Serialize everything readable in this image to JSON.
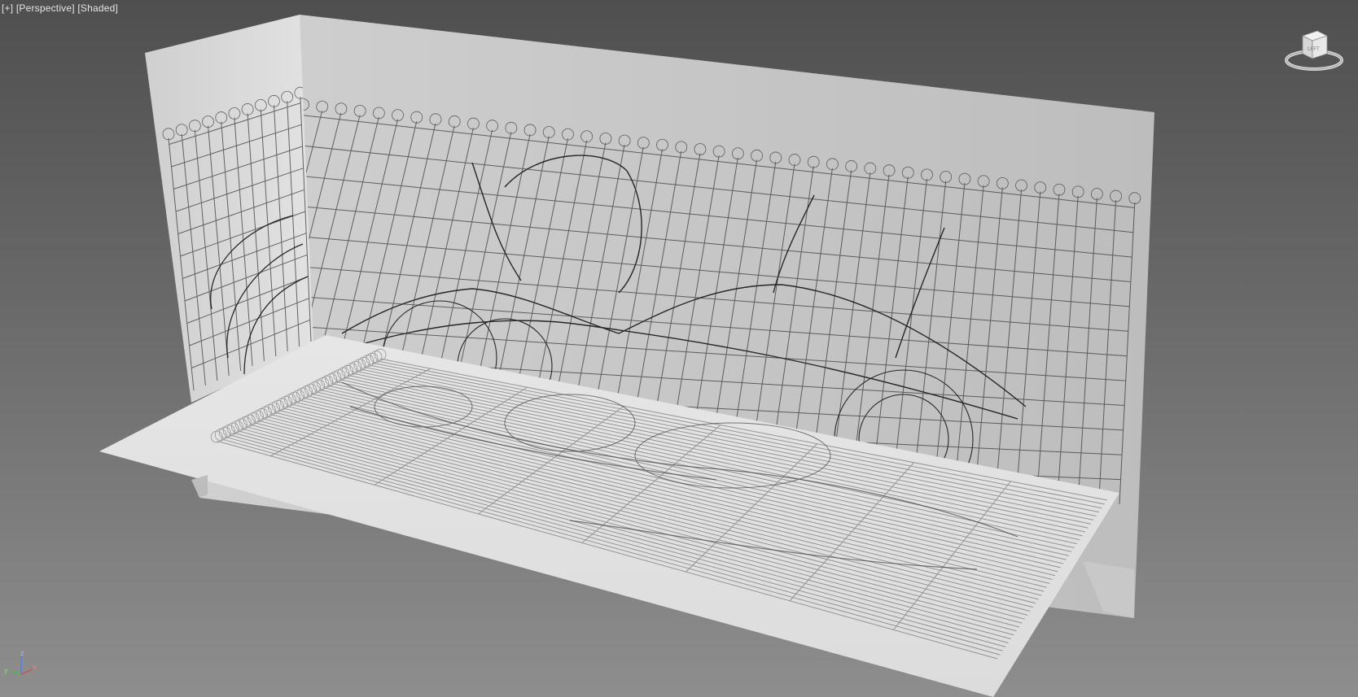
{
  "viewport": {
    "label_plus": "[+]",
    "label_view": "[Perspective]",
    "label_shading": "[Shaded]"
  },
  "viewcube": {
    "face_label": "LEFT",
    "icon": "viewcube-icon"
  },
  "axis_tripod": {
    "x": "x",
    "y": "y",
    "z": "z"
  },
  "colors": {
    "background_top": "#4f4f4f",
    "background_bottom": "#8e8e8e",
    "plane_light": "#e4e4e4",
    "plane_wall": "#c4c4c4",
    "sketch_line": "#2a2a2a",
    "axis_x": "#e04040",
    "axis_y": "#40c040",
    "axis_z": "#4a7cff"
  }
}
